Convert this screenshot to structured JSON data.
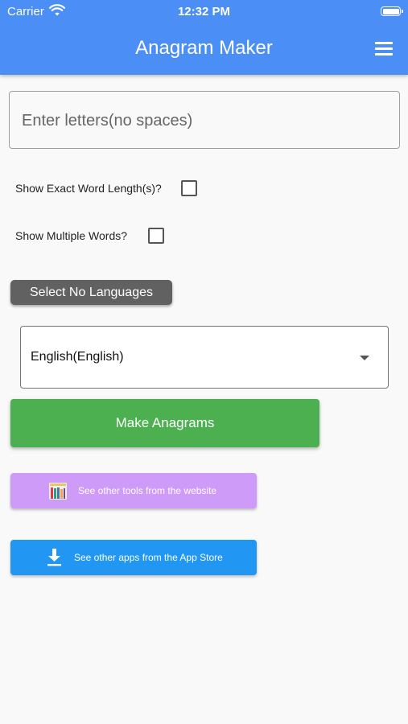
{
  "status_bar": {
    "carrier": "Carrier",
    "time": "12:32 PM"
  },
  "app_bar": {
    "title": "Anagram Maker",
    "menu_icon": "hamburger-menu-icon"
  },
  "input": {
    "placeholder": "Enter letters(no spaces)",
    "value": ""
  },
  "options": {
    "exact_length_label": "Show Exact Word Length(s)?",
    "exact_length_checked": false,
    "multiple_words_label": "Show Multiple Words?",
    "multiple_words_checked": false
  },
  "select_no_languages_label": "Select No Languages",
  "language_dropdown": {
    "selected": "English(English)"
  },
  "make_button_label": "Make Anagrams",
  "links": {
    "website_label": "See other tools from the website",
    "website_icon": "books-icon",
    "app_store_label": "See other apps from the App Store",
    "app_store_icon": "download-icon"
  },
  "colors": {
    "app_bar": "#4b8ef5",
    "make_button": "#4cb050",
    "website_button": "#cf9bf8",
    "app_store_button": "#2196f3",
    "select_no_languages": "#616161"
  }
}
